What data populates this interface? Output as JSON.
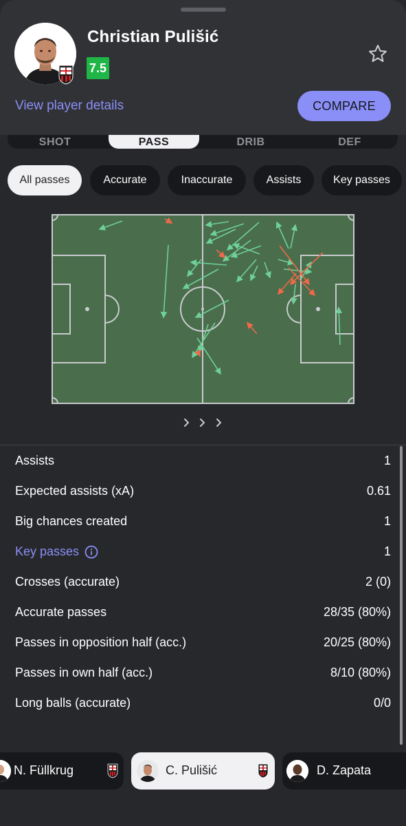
{
  "player": {
    "name": "Christian Pulišić",
    "rating": "7.5",
    "details_link": "View player details",
    "compare_label": "COMPARE"
  },
  "tabs": [
    {
      "label": "SHOT",
      "active": false
    },
    {
      "label": "PASS",
      "active": true
    },
    {
      "label": "DRIB",
      "active": false
    },
    {
      "label": "DEF",
      "active": false
    }
  ],
  "filters": [
    {
      "label": "All passes",
      "active": true
    },
    {
      "label": "Accurate",
      "active": false
    },
    {
      "label": "Inaccurate",
      "active": false
    },
    {
      "label": "Assists",
      "active": false
    },
    {
      "label": "Key passes",
      "active": false
    }
  ],
  "colors": {
    "pitch": "#4a6d4b",
    "accurate": "#6fd09a",
    "inaccurate": "#ef6a4a",
    "accent": "#8a8ff7",
    "rating": "#1fb547"
  },
  "stats": [
    {
      "label": "Assists",
      "value": "1",
      "link": false
    },
    {
      "label": "Expected assists (xA)",
      "value": "0.61",
      "link": false
    },
    {
      "label": "Big chances created",
      "value": "1",
      "link": false
    },
    {
      "label": "Key passes",
      "value": "1",
      "link": true
    },
    {
      "label": "Crosses (accurate)",
      "value": "2 (0)",
      "link": false
    },
    {
      "label": "Accurate passes",
      "value": "28/35 (80%)",
      "link": false
    },
    {
      "label": "Passes in opposition half (acc.)",
      "value": "20/25 (80%)",
      "link": false
    },
    {
      "label": "Passes in own half (acc.)",
      "value": "8/10 (80%)",
      "link": false
    },
    {
      "label": "Long balls (accurate)",
      "value": "0/0",
      "link": false
    }
  ],
  "carousel": [
    {
      "name": "N. Füllkrug",
      "active": false
    },
    {
      "name": "C. Pulišić",
      "active": true
    },
    {
      "name": "D. Zapata",
      "active": false
    }
  ],
  "icons": {
    "star": "star-icon",
    "info": "info-icon",
    "club": "ac-milan-badge-icon",
    "pager": "chevron-right-icon"
  }
}
